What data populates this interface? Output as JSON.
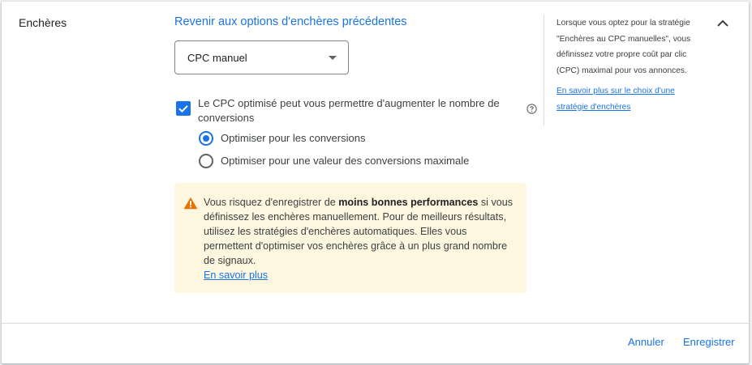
{
  "section": {
    "title": "Enchères"
  },
  "bidding": {
    "revert_link": "Revenir aux options d'enchères précédentes",
    "strategy_select": {
      "value": "CPC manuel"
    },
    "enhanced_cpc": {
      "checked": true,
      "label": "Le CPC optimisé peut vous permettre d'augmenter le nombre de conversions",
      "help_icon": "help-circle-icon"
    },
    "options": [
      {
        "label": "Optimiser pour les conversions",
        "selected": true
      },
      {
        "label": "Optimiser pour une valeur des conversions maximale",
        "selected": false
      }
    ]
  },
  "warning": {
    "icon": "warning-triangle-icon",
    "text_before": "Vous risquez d'enregistrer de ",
    "text_bold": "moins bonnes performances",
    "text_after": " si vous définissez les enchères manuellement. Pour de meilleurs résultats, utilisez les stratégies d'enchères automatiques. Elles vous permettent d'optimiser vos enchères grâce à un plus grand nombre de signaux.",
    "link": "En savoir plus"
  },
  "sidebar": {
    "help_text": "Lorsque vous optez pour la stratégie \"Enchères au CPC manuelles\", vous définissez votre propre coût par clic (CPC) maximal pour vos annonces.",
    "help_link": "En savoir plus sur le choix d'une stratégie d'enchères",
    "collapse_icon": "chevron-up-icon"
  },
  "footer": {
    "cancel_label": "Annuler",
    "save_label": "Enregistrer"
  },
  "colors": {
    "accent": "#1a73e8",
    "warning_bg": "#fef7e0",
    "warning_icon": "#e37400"
  }
}
